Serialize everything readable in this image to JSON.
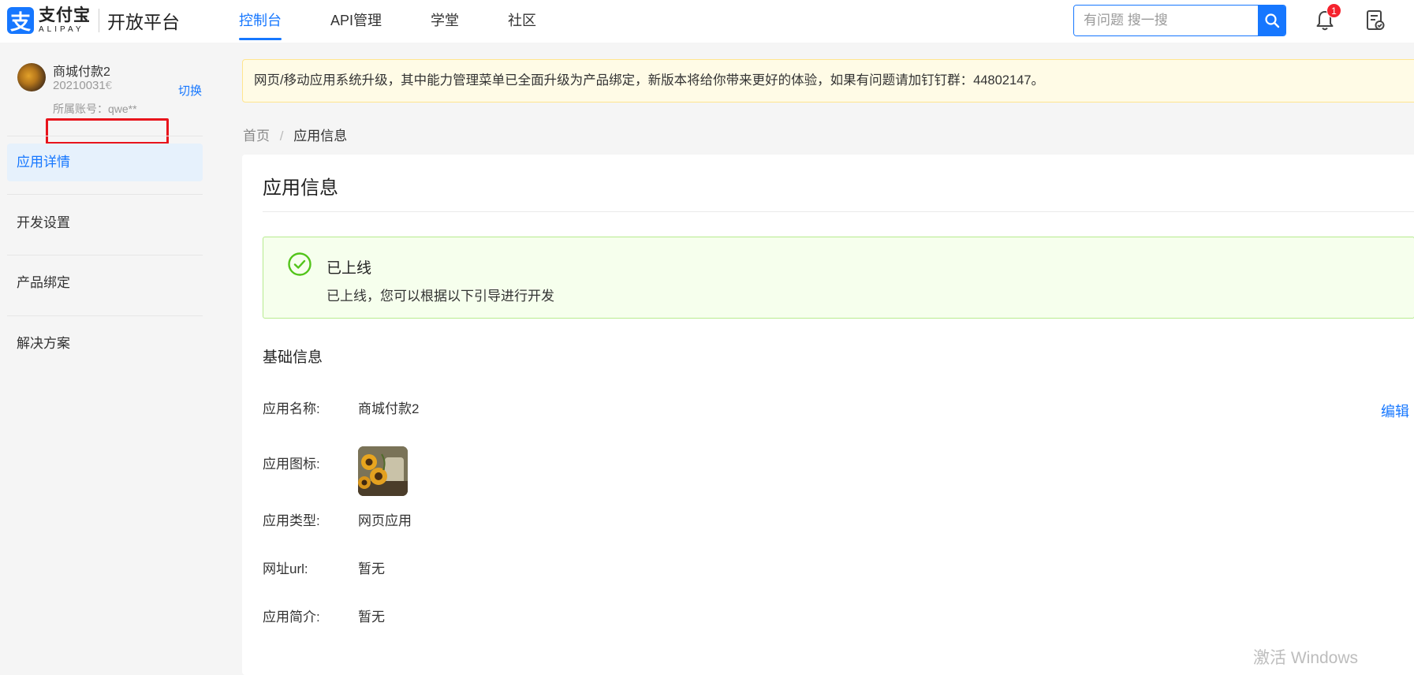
{
  "brand": {
    "mark": "支",
    "name_cn": "支付宝",
    "name_en": "ALIPAY",
    "platform": "开放平台"
  },
  "nav": {
    "items": [
      {
        "label": "控制台",
        "active": true
      },
      {
        "label": "API管理",
        "active": false
      },
      {
        "label": "学堂",
        "active": false
      },
      {
        "label": "社区",
        "active": false
      }
    ]
  },
  "search": {
    "placeholder": "有问题 搜一搜"
  },
  "notifications": {
    "count": "1"
  },
  "account": {
    "app_name": "商城付款2",
    "app_id": "20210031€",
    "switch_label": "切换",
    "owner": "所属账号：qwe**"
  },
  "sidebar": {
    "items": [
      {
        "label": "应用详情",
        "active": true
      },
      {
        "label": "开发设置",
        "active": false
      },
      {
        "label": "产品绑定",
        "active": false
      },
      {
        "label": "解决方案",
        "active": false
      }
    ]
  },
  "notice": {
    "text": "网页/移动应用系统升级，其中能力管理菜单已全面升级为产品绑定，新版本将给你带来更好的体验，如果有问题请加钉钉群：44802147。"
  },
  "breadcrumb": {
    "home": "首页",
    "separator": "/",
    "current": "应用信息"
  },
  "page": {
    "title": "应用信息"
  },
  "status": {
    "title": "已上线",
    "description": "已上线，您可以根据以下引导进行开发"
  },
  "basic_info": {
    "section_title": "基础信息",
    "edit_label": "编辑",
    "fields": {
      "app_name": {
        "label": "应用名称:",
        "value": "商城付款2"
      },
      "app_icon": {
        "label": "应用图标:"
      },
      "app_type": {
        "label": "应用类型:",
        "value": "网页应用"
      },
      "url": {
        "label": "网址url:",
        "value": "暂无"
      },
      "intro": {
        "label": "应用简介:",
        "value": "暂无"
      }
    }
  },
  "watermark": "激活 Windows",
  "colors": {
    "primary": "#1677ff",
    "success": "#52c41a",
    "danger": "#f5222d",
    "highlight_box": "#e8141c"
  }
}
